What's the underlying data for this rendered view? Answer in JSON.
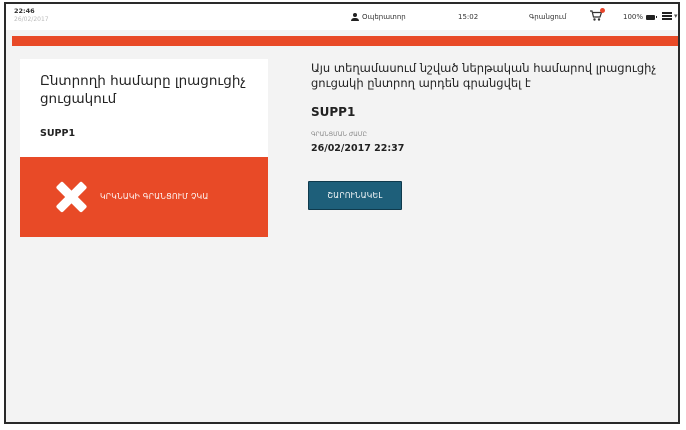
{
  "statusbar": {
    "time": "22:46",
    "date": "26/02/2017",
    "user": "Օպերատոր",
    "clock": "15:02",
    "store": "Գրանցում",
    "battery": "100%"
  },
  "card": {
    "title": "Ընտրողի համարը լրացուցիչ ցուցակում",
    "code": "SUPP1",
    "error_text": "ԿՐԿՆԱԿԻ ԳՐԱՆՑՈՒՄ ՉԿԱ"
  },
  "message": "Այս տեղամասում նշված ներթական համարով լրացուցիչ ցուցակի ընտրող արդեն գրանցվել է",
  "code": "SUPP1",
  "date_label": "ԳՐԱՆՑՄԱՆ ԺԱՄԸ",
  "date_value": "26/02/2017 22:37",
  "button_label": "ՇԱՐՈՒՆԱԿԵԼ",
  "colors": {
    "accent": "#e84a27",
    "button": "#1e5f7a"
  }
}
